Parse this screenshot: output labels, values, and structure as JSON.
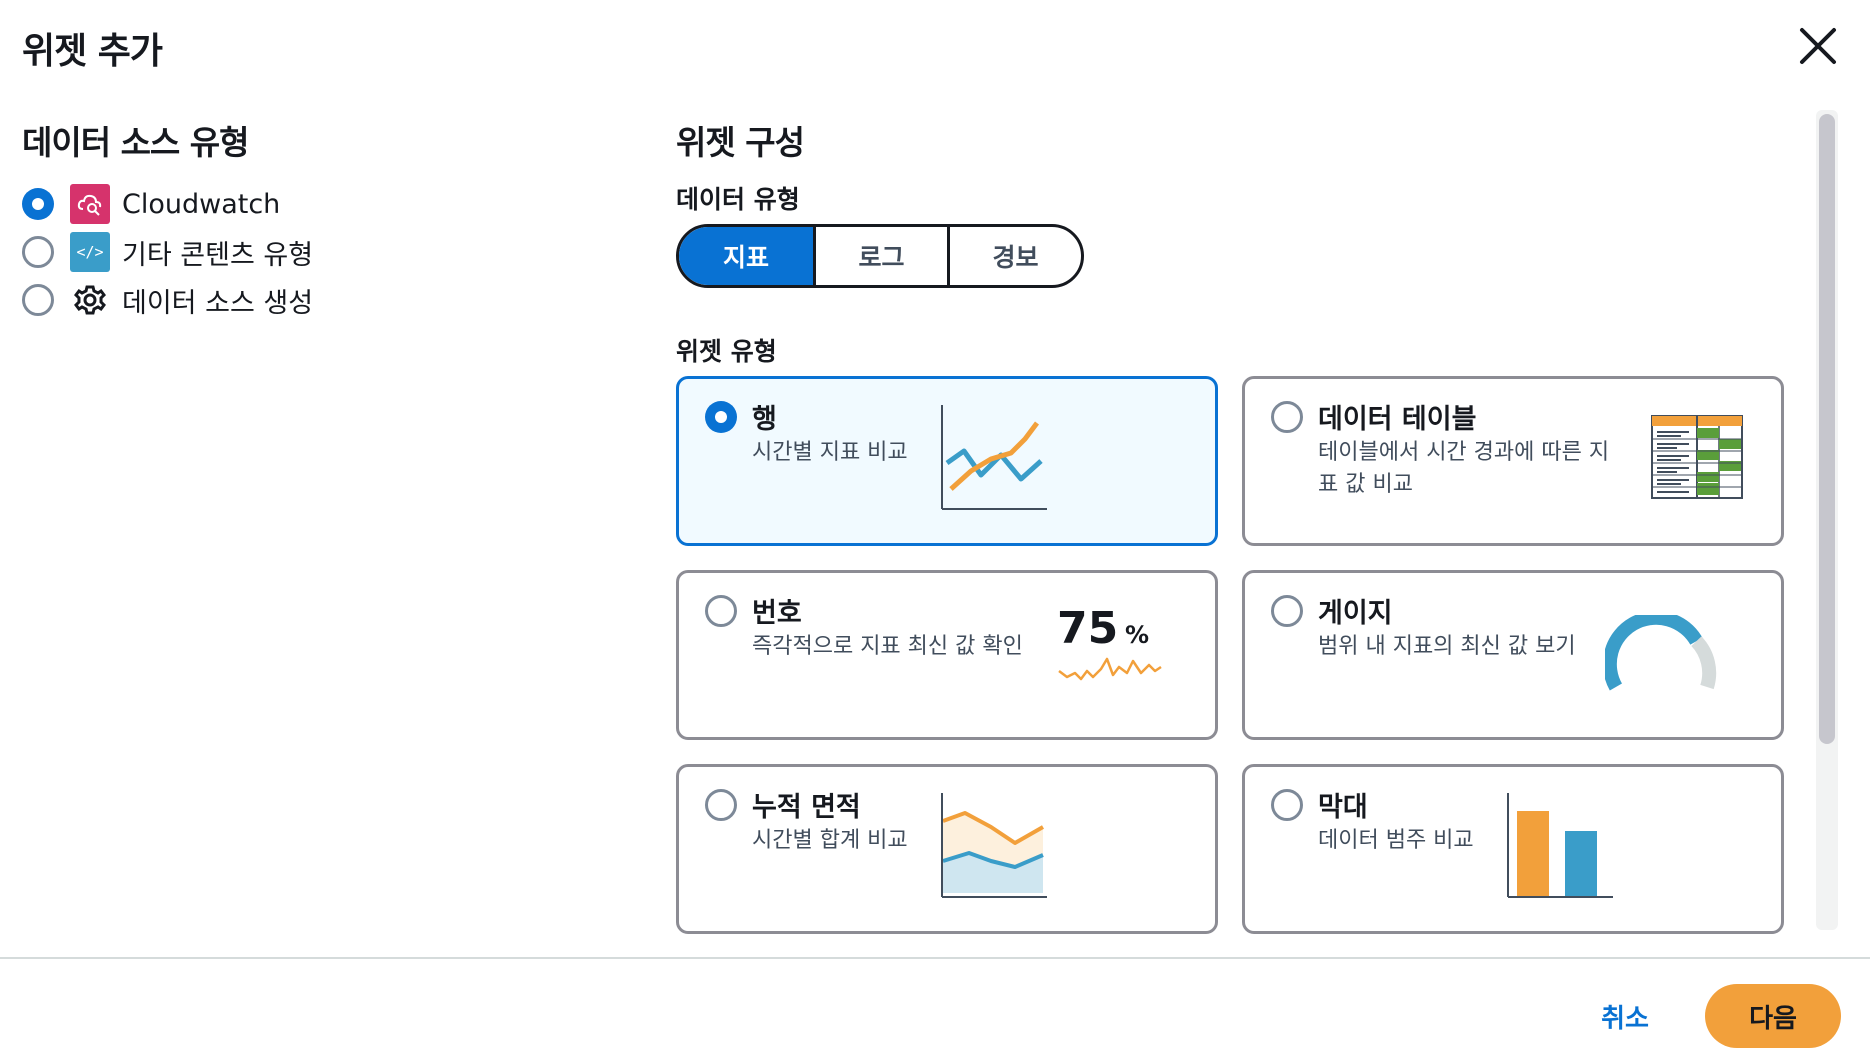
{
  "dialog": {
    "title": "위젯 추가",
    "close_icon": "close-icon"
  },
  "data_source": {
    "heading": "데이터 소스 유형",
    "options": [
      {
        "label": "Cloudwatch",
        "icon": "cloudwatch-icon",
        "selected": true,
        "color": "#d6336c"
      },
      {
        "label": "기타 콘텐츠 유형",
        "icon": "code-icon",
        "selected": false,
        "color": "#3a9dc9"
      },
      {
        "label": "데이터 소스 생성",
        "icon": "gear-icon",
        "selected": false
      }
    ]
  },
  "widget_config": {
    "heading": "위젯 구성",
    "data_type_label": "데이터 유형",
    "data_types": [
      {
        "label": "지표",
        "active": true
      },
      {
        "label": "로그",
        "active": false
      },
      {
        "label": "경보",
        "active": false
      }
    ],
    "widget_type_label": "위젯 유형",
    "widget_types": [
      {
        "title": "행",
        "description": "시간별 지표 비교",
        "icon": "line-chart-icon",
        "selected": true
      },
      {
        "title": "데이터 테이블",
        "description_line1": "테이블에서 시간 경과에 따른 지",
        "description_line2": "표 값 비교",
        "icon": "table-icon",
        "selected": false
      },
      {
        "title": "번호",
        "description": "즉각적으로 지표 최신 값 확인",
        "icon": "number-icon",
        "selected": false,
        "sample_value": "75",
        "sample_unit": "%"
      },
      {
        "title": "게이지",
        "description": "범위 내 지표의 최신 값 보기",
        "icon": "gauge-icon",
        "selected": false
      },
      {
        "title": "누적 면적",
        "description": "시간별 합계 비교",
        "icon": "stacked-area-icon",
        "selected": false
      },
      {
        "title": "막대",
        "description": "데이터 범주 비교",
        "icon": "bar-chart-icon",
        "selected": false
      }
    ]
  },
  "footer": {
    "cancel_label": "취소",
    "next_label": "다음"
  },
  "colors": {
    "accent_blue": "#0972d3",
    "chart_orange": "#f2a03b",
    "chart_blue": "#3a9dc9",
    "table_green": "#5a9e3a",
    "primary_button": "#f2a03b"
  }
}
